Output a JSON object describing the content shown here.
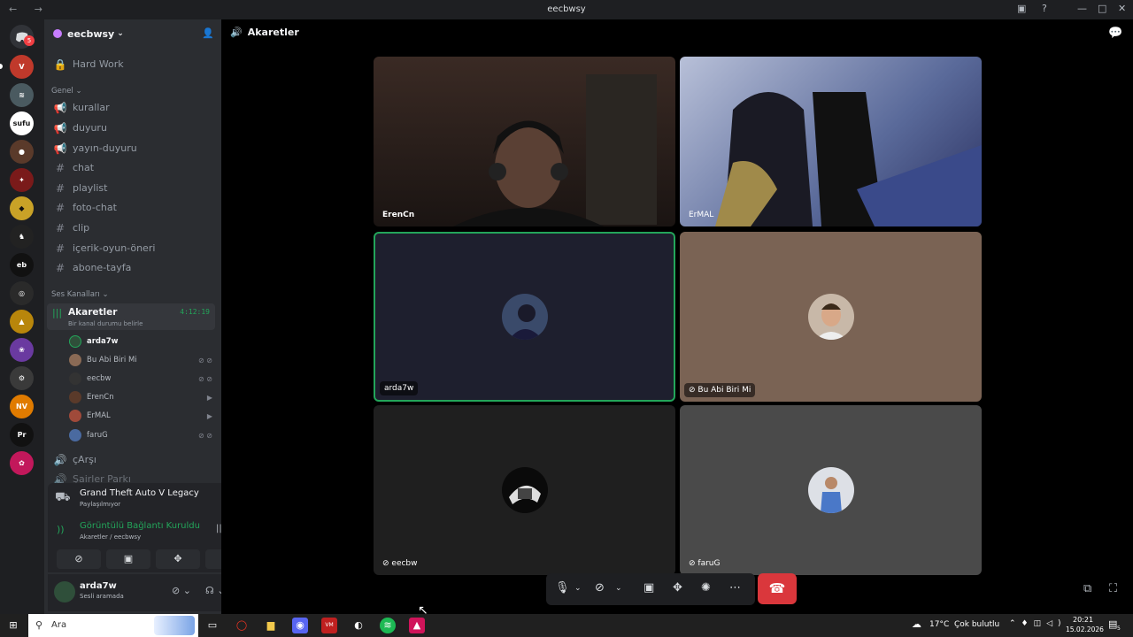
{
  "window": {
    "title": "eecbwsy",
    "nav_arrows": "← →"
  },
  "server": {
    "name": "eecbwsy",
    "chevron": "⌄"
  },
  "guild_badge": "5",
  "channels": {
    "top": {
      "label": "Hard Work",
      "icon": "lock-icon"
    },
    "category_general": "Genel",
    "general": [
      {
        "label": "kurallar",
        "icon": "megaphone-icon"
      },
      {
        "label": "duyuru",
        "icon": "megaphone-icon"
      },
      {
        "label": "yayın-duyuru",
        "icon": "megaphone-icon"
      },
      {
        "label": "chat",
        "icon": "hash-icon"
      },
      {
        "label": "playlist",
        "icon": "hash-icon"
      },
      {
        "label": "foto-chat",
        "icon": "hash-icon"
      },
      {
        "label": "clip",
        "icon": "hash-icon"
      },
      {
        "label": "içerik-oyun-öneri",
        "icon": "hash-icon"
      },
      {
        "label": "abone-tayfa",
        "icon": "hash-icon"
      }
    ],
    "category_voice": "Ses Kanalları",
    "active_voice": {
      "label": "Akaretler",
      "timer": "4:12:19",
      "status": "Bir kanal durumu belirle"
    },
    "voice_users": [
      {
        "name": "arda7w",
        "icons": ""
      },
      {
        "name": "Bu Abi Biri Mi",
        "icons": "⊘ ⊘"
      },
      {
        "name": "eecbw",
        "icons": "⊘ ⊘"
      },
      {
        "name": "ErenCn",
        "icons": "▶"
      },
      {
        "name": "ErMAL",
        "icons": "▶"
      },
      {
        "name": "faruG",
        "icons": "⊘ ⊘"
      }
    ],
    "more": [
      {
        "label": "çArşı"
      },
      {
        "label": "Şairler Parkı"
      }
    ]
  },
  "activity": {
    "game": "Grand Theft Auto V Legacy",
    "status": "Paylaşılmıyor"
  },
  "connection": {
    "title": "Görüntülü Bağlantı Kuruldu",
    "sub": "Akaretler / eecbwsy"
  },
  "user": {
    "name": "arda7w",
    "status": "Sesli aramada"
  },
  "main": {
    "channel": "Akaretler"
  },
  "tiles": [
    {
      "label": "ErenCn",
      "kind": "video"
    },
    {
      "label": "ErMAL",
      "kind": "video"
    },
    {
      "label": "arda7w",
      "kind": "avatar",
      "bg": "#1e1f2e"
    },
    {
      "label": "Bu Abi Biri Mi",
      "kind": "avatar",
      "bg": "#7a6354"
    },
    {
      "label": "eecbw",
      "kind": "avatar",
      "bg": "#1f1f1f"
    },
    {
      "label": "faruG",
      "kind": "avatar",
      "bg": "#4a4a4a"
    }
  ],
  "taskbar": {
    "search": "Ara",
    "weather": "17°C  Çok bulutlu",
    "time": "20:21",
    "date": "15.02.2026",
    "notif": "5"
  }
}
